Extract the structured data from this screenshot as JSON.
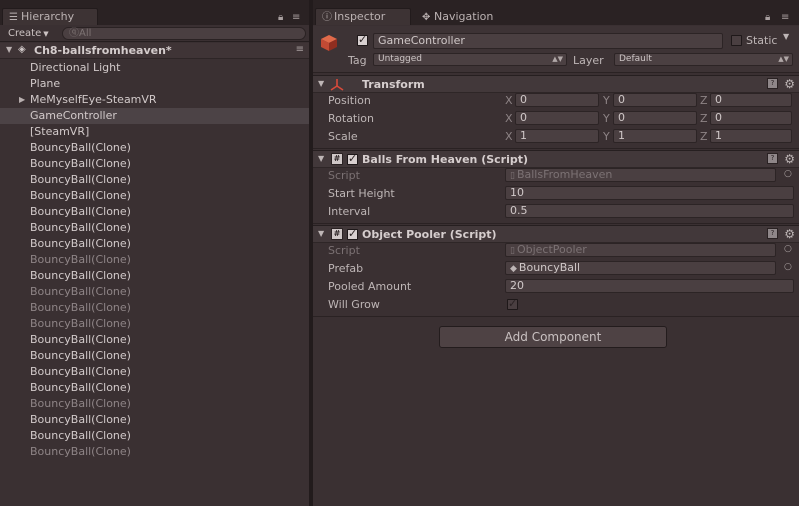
{
  "hierarchy": {
    "tab_label": "Hierarchy",
    "create_label": "Create",
    "search_placeholder": "ⓠAll",
    "scene_name": "Ch8-ballsfromheaven*",
    "items": [
      {
        "label": "Directional Light",
        "dim": false,
        "expand": false,
        "selected": false
      },
      {
        "label": "Plane",
        "dim": false,
        "expand": false,
        "selected": false
      },
      {
        "label": "MeMyselfEye-SteamVR",
        "dim": false,
        "expand": true,
        "selected": false
      },
      {
        "label": "GameController",
        "dim": false,
        "expand": false,
        "selected": true
      },
      {
        "label": "[SteamVR]",
        "dim": false,
        "expand": false,
        "selected": false
      },
      {
        "label": "BouncyBall(Clone)",
        "dim": false,
        "expand": false,
        "selected": false
      },
      {
        "label": "BouncyBall(Clone)",
        "dim": false,
        "expand": false,
        "selected": false
      },
      {
        "label": "BouncyBall(Clone)",
        "dim": false,
        "expand": false,
        "selected": false
      },
      {
        "label": "BouncyBall(Clone)",
        "dim": false,
        "expand": false,
        "selected": false
      },
      {
        "label": "BouncyBall(Clone)",
        "dim": false,
        "expand": false,
        "selected": false
      },
      {
        "label": "BouncyBall(Clone)",
        "dim": false,
        "expand": false,
        "selected": false
      },
      {
        "label": "BouncyBall(Clone)",
        "dim": false,
        "expand": false,
        "selected": false
      },
      {
        "label": "BouncyBall(Clone)",
        "dim": true,
        "expand": false,
        "selected": false
      },
      {
        "label": "BouncyBall(Clone)",
        "dim": false,
        "expand": false,
        "selected": false
      },
      {
        "label": "BouncyBall(Clone)",
        "dim": true,
        "expand": false,
        "selected": false
      },
      {
        "label": "BouncyBall(Clone)",
        "dim": true,
        "expand": false,
        "selected": false
      },
      {
        "label": "BouncyBall(Clone)",
        "dim": true,
        "expand": false,
        "selected": false
      },
      {
        "label": "BouncyBall(Clone)",
        "dim": false,
        "expand": false,
        "selected": false
      },
      {
        "label": "BouncyBall(Clone)",
        "dim": false,
        "expand": false,
        "selected": false
      },
      {
        "label": "BouncyBall(Clone)",
        "dim": false,
        "expand": false,
        "selected": false
      },
      {
        "label": "BouncyBall(Clone)",
        "dim": false,
        "expand": false,
        "selected": false
      },
      {
        "label": "BouncyBall(Clone)",
        "dim": true,
        "expand": false,
        "selected": false
      },
      {
        "label": "BouncyBall(Clone)",
        "dim": false,
        "expand": false,
        "selected": false
      },
      {
        "label": "BouncyBall(Clone)",
        "dim": false,
        "expand": false,
        "selected": false
      },
      {
        "label": "BouncyBall(Clone)",
        "dim": true,
        "expand": false,
        "selected": false
      }
    ]
  },
  "inspector": {
    "tab_label": "Inspector",
    "nav_tab_label": "Navigation",
    "object_name": "GameController",
    "static_label": "Static",
    "tag_label": "Tag",
    "tag_value": "Untagged",
    "layer_label": "Layer",
    "layer_value": "Default",
    "transform": {
      "title": "Transform",
      "position_label": "Position",
      "rotation_label": "Rotation",
      "scale_label": "Scale",
      "x": "X",
      "y": "Y",
      "z": "Z",
      "position": [
        "0",
        "0",
        "0"
      ],
      "rotation": [
        "0",
        "0",
        "0"
      ],
      "scale": [
        "1",
        "1",
        "1"
      ]
    },
    "balls": {
      "title": "Balls From Heaven (Script)",
      "script_label": "Script",
      "script_value": "BallsFromHeaven",
      "start_height_label": "Start Height",
      "start_height_value": "10",
      "interval_label": "Interval",
      "interval_value": "0.5"
    },
    "pooler": {
      "title": "Object Pooler (Script)",
      "script_label": "Script",
      "script_value": "ObjectPooler",
      "prefab_label": "Prefab",
      "prefab_value": "BouncyBall",
      "pooled_amount_label": "Pooled Amount",
      "pooled_amount_value": "20",
      "will_grow_label": "Will Grow"
    },
    "add_component_label": "Add Component"
  }
}
